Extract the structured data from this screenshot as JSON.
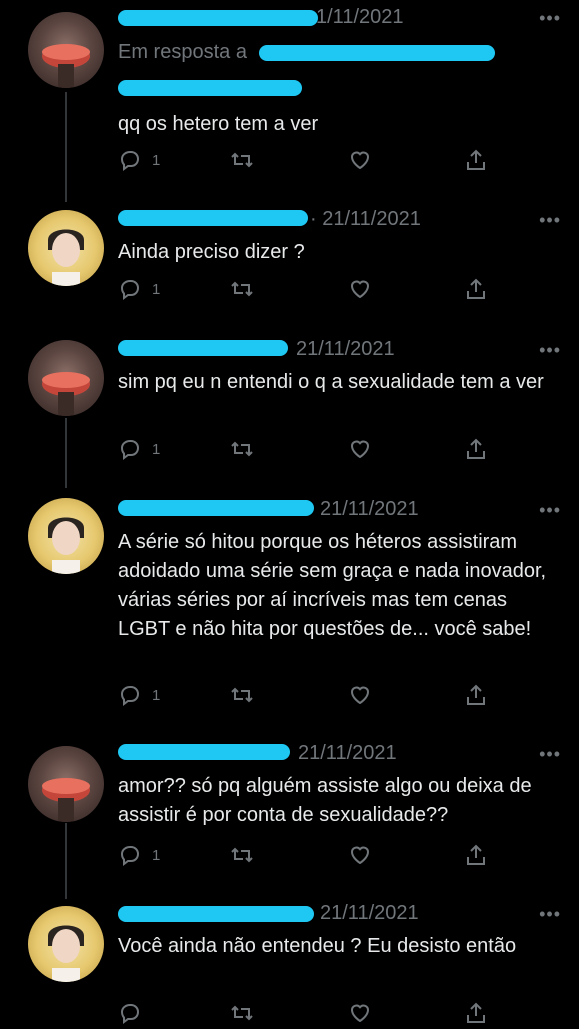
{
  "tweets": [
    {
      "avatar": "user-a-watermelon",
      "date": "1/11/2021",
      "reply_prefix": "Em resposta a",
      "text": "qq os hetero tem a ver",
      "replies": "1"
    },
    {
      "avatar": "user-b-portrait",
      "date": "· 21/11/2021",
      "text": "Ainda preciso dizer ?",
      "replies": "1"
    },
    {
      "avatar": "user-a-watermelon",
      "date": "21/11/2021",
      "text": "sim pq eu n entendi o q a sexualidade tem a ver",
      "replies": "1"
    },
    {
      "avatar": "user-b-portrait",
      "date": "21/11/2021",
      "text": "A série só hitou porque os héteros assistiram adoidado uma série sem graça e nada inovador, várias séries por aí incríveis mas tem cenas LGBT e não hita por questões de... você sabe!",
      "replies": "1"
    },
    {
      "avatar": "user-a-watermelon",
      "date": "21/11/2021",
      "text": "amor?? só pq alguém assiste algo ou deixa de assistir é por conta de sexualidade??",
      "replies": "1"
    },
    {
      "avatar": "user-b-portrait",
      "date": "21/11/2021",
      "text": "Você ainda não entendeu ? Eu desisto então",
      "replies": ""
    }
  ],
  "more_glyph": "•••",
  "colors": {
    "background": "#000000",
    "text": "#e7e9ea",
    "muted": "#71767b",
    "redaction": "#1ec8f2"
  }
}
